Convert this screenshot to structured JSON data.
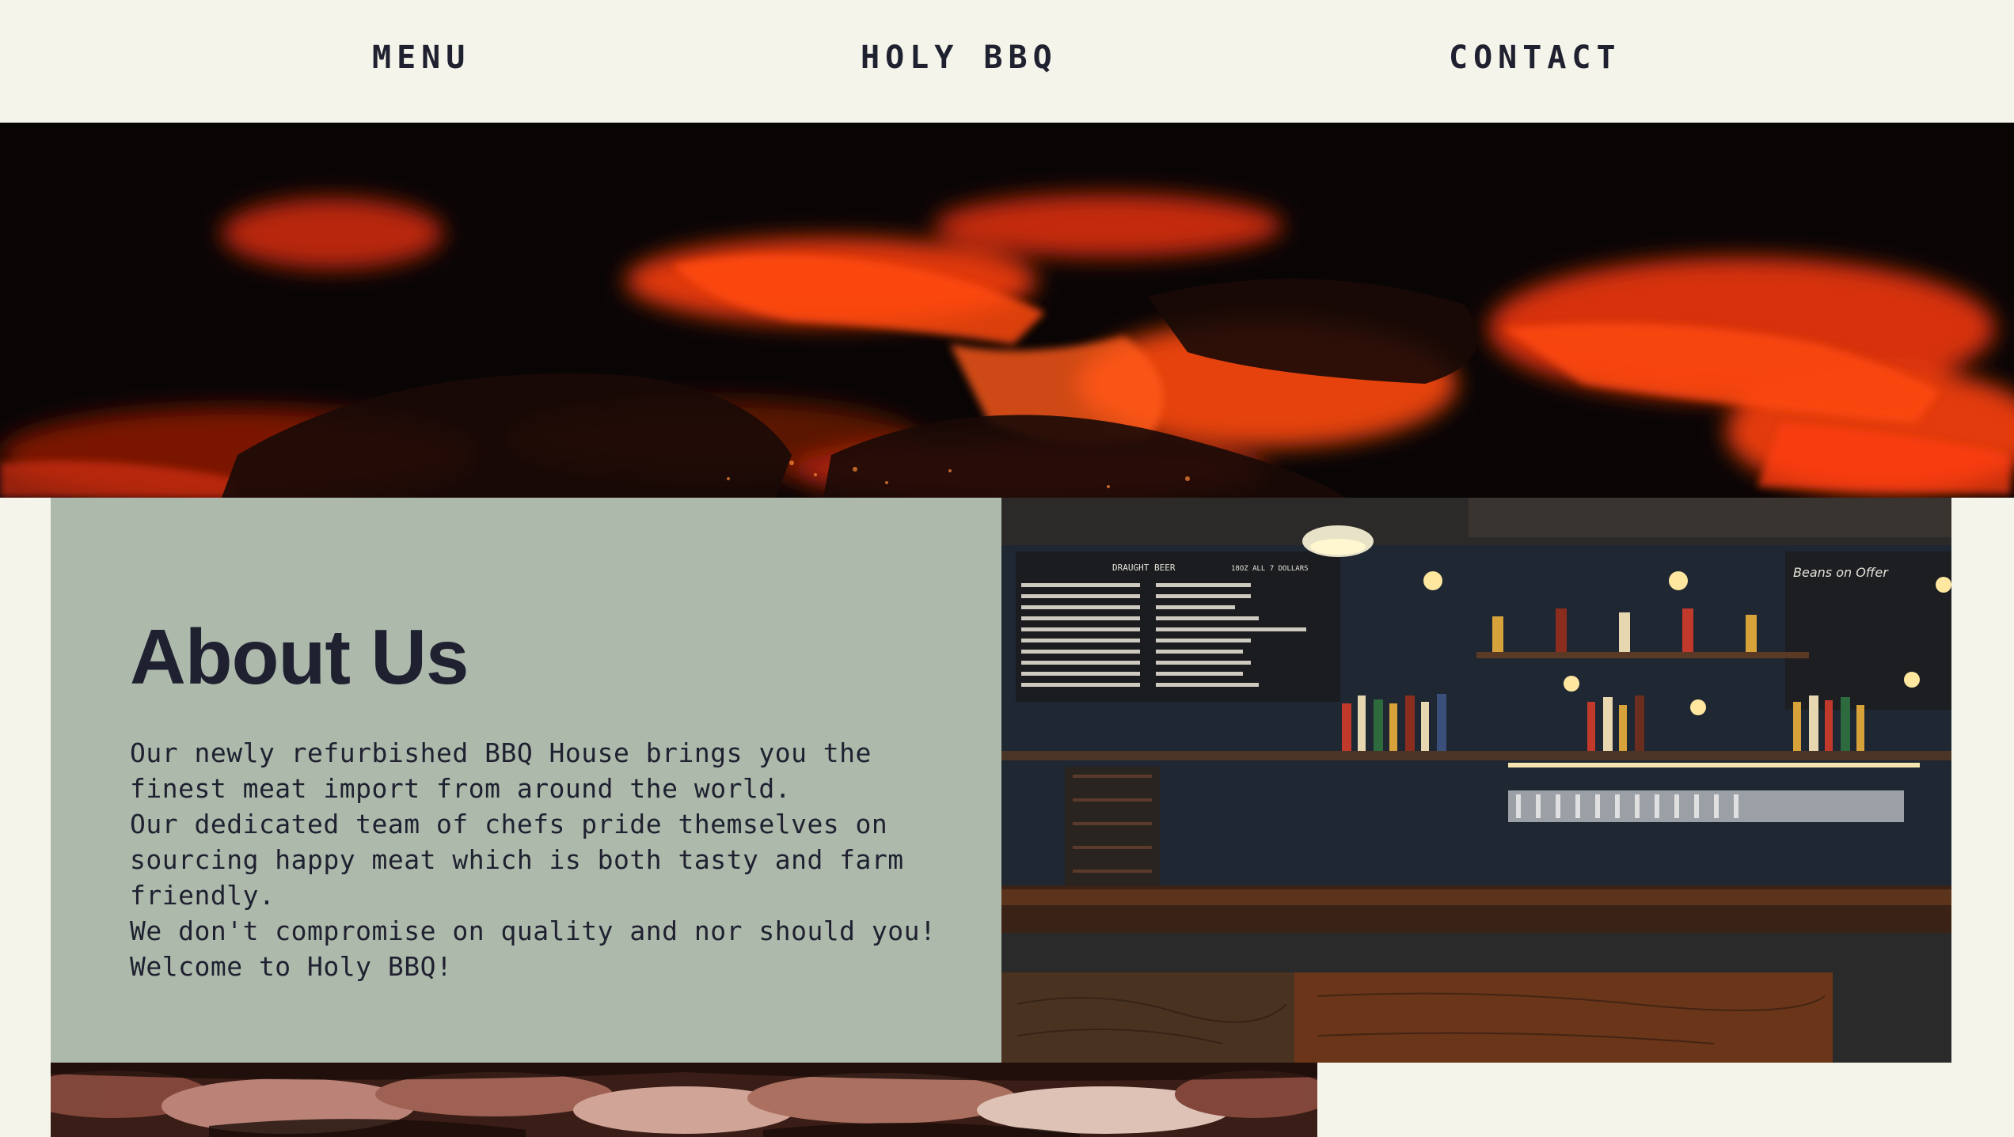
{
  "nav": {
    "menu_label": "MENU",
    "brand_label": "HOLY BBQ",
    "contact_label": "CONTACT"
  },
  "hero": {
    "image": "burning-embers-photo"
  },
  "about": {
    "title": "About Us",
    "paragraphs": [
      "Our newly refurbished BBQ House brings you the finest meat import from around the world.",
      "Our dedicated team of chefs pride themselves on sourcing happy meat which is both tasty and farm friendly.",
      "We don't compromise on quality and nor should you! Welcome to Holy BBQ!"
    ]
  },
  "bar_photo": {
    "image": "bar-interior-photo",
    "chalkboard_heading": "DRAUGHT BEER",
    "chalkboard_sub": "18OZ   ALL 7 DOLLARS",
    "chalkboard_right": "Beans on Offer"
  },
  "meat_photo": {
    "image": "smoked-meat-photo"
  },
  "colors": {
    "background": "#f5f4ea",
    "text": "#1f2130",
    "about_panel": "#adb9ab",
    "ember": "#e8340c"
  }
}
